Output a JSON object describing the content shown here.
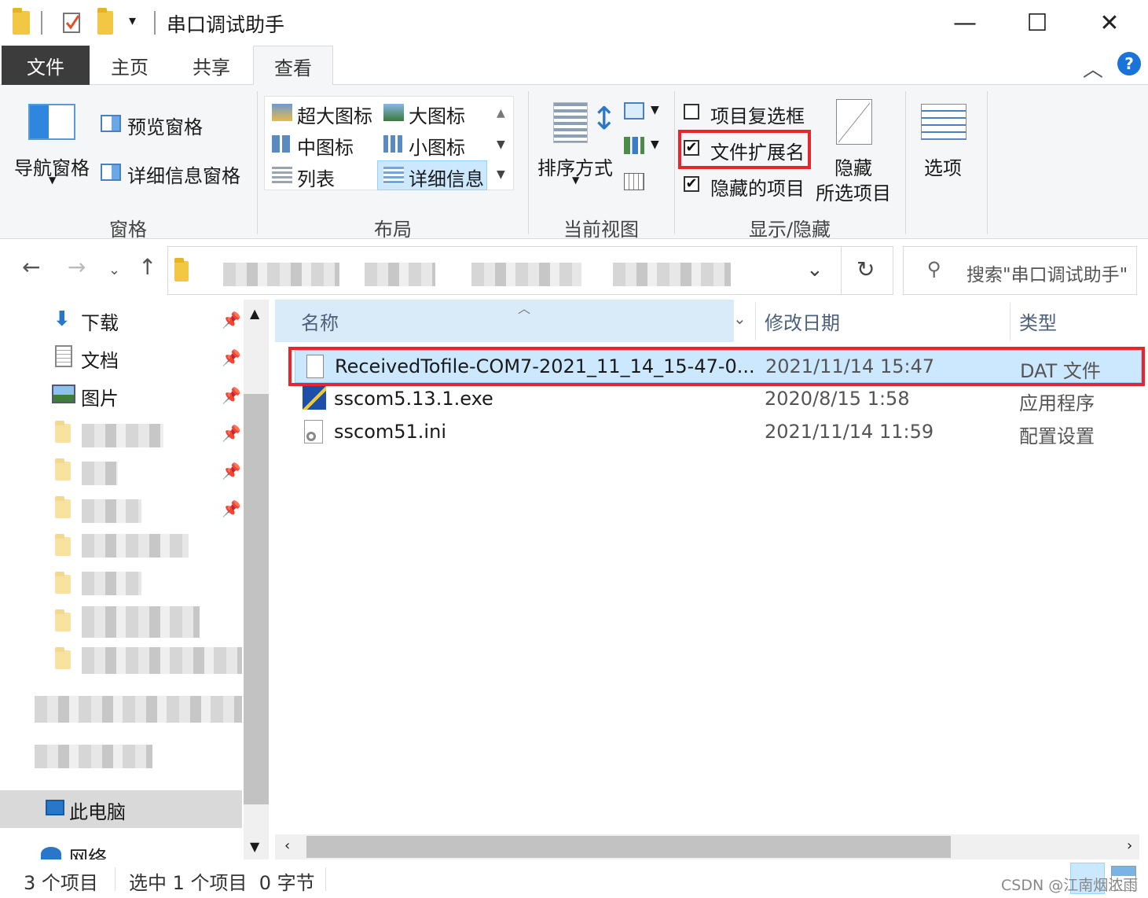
{
  "window": {
    "title": "串口调试助手",
    "minimize_glyph": "—",
    "maximize_glyph": "☐",
    "close_glyph": "✕"
  },
  "ribbon_tabs": {
    "file": "文件",
    "home": "主页",
    "share": "共享",
    "view": "查看"
  },
  "ribbon": {
    "panes": {
      "nav_pane": "导航窗格",
      "preview_pane": "预览窗格",
      "details_pane": "详细信息窗格",
      "group_label": "窗格"
    },
    "layout": {
      "extra_large_icons": "超大图标",
      "large_icons": "大图标",
      "medium_icons": "中图标",
      "small_icons": "小图标",
      "list": "列表",
      "details": "详细信息",
      "group_label": "布局"
    },
    "current_view": {
      "sort_by": "排序方式",
      "group_label": "当前视图"
    },
    "show_hide": {
      "item_checkboxes": "项目复选框",
      "item_checkboxes_checked": false,
      "file_extensions": "文件扩展名",
      "file_extensions_checked": true,
      "hidden_items": "隐藏的项目",
      "hidden_items_checked": true,
      "hide_selected_line1": "隐藏",
      "hide_selected_line2": "所选项目",
      "group_label": "显示/隐藏"
    },
    "options": "选项"
  },
  "address": {
    "search_placeholder": "搜索\"串口调试助手\""
  },
  "nav_pane": {
    "items": [
      {
        "label": "下载",
        "icon": "download-arrow-icon"
      },
      {
        "label": "文档",
        "icon": "document-icon"
      },
      {
        "label": "图片",
        "icon": "picture-icon"
      }
    ],
    "this_pc": "此电脑",
    "network": "网络"
  },
  "file_list": {
    "columns": {
      "name": "名称",
      "date": "修改日期",
      "type": "类型"
    },
    "files": [
      {
        "name": "ReceivedTofile-COM7-2021_11_14_15-47-0...",
        "date": "2021/11/14 15:47",
        "type": "DAT 文件",
        "icon": "blank-file-icon"
      },
      {
        "name": "sscom5.13.1.exe",
        "date": "2020/8/15 1:58",
        "type": "应用程序",
        "icon": "exe-app-icon"
      },
      {
        "name": "sscom51.ini",
        "date": "2021/11/14 11:59",
        "type": "配置设置",
        "icon": "config-file-icon"
      }
    ]
  },
  "status": {
    "item_count": "3 个项目",
    "selection": "选中 1 个项目  0 字节",
    "watermark": "CSDN @江南烟浓雨"
  },
  "colors": {
    "highlight_red": "#e8252c",
    "selection_bg": "#cce8ff",
    "file_tab_bg": "#3c3c3c",
    "help_blue": "#1a73d9"
  }
}
